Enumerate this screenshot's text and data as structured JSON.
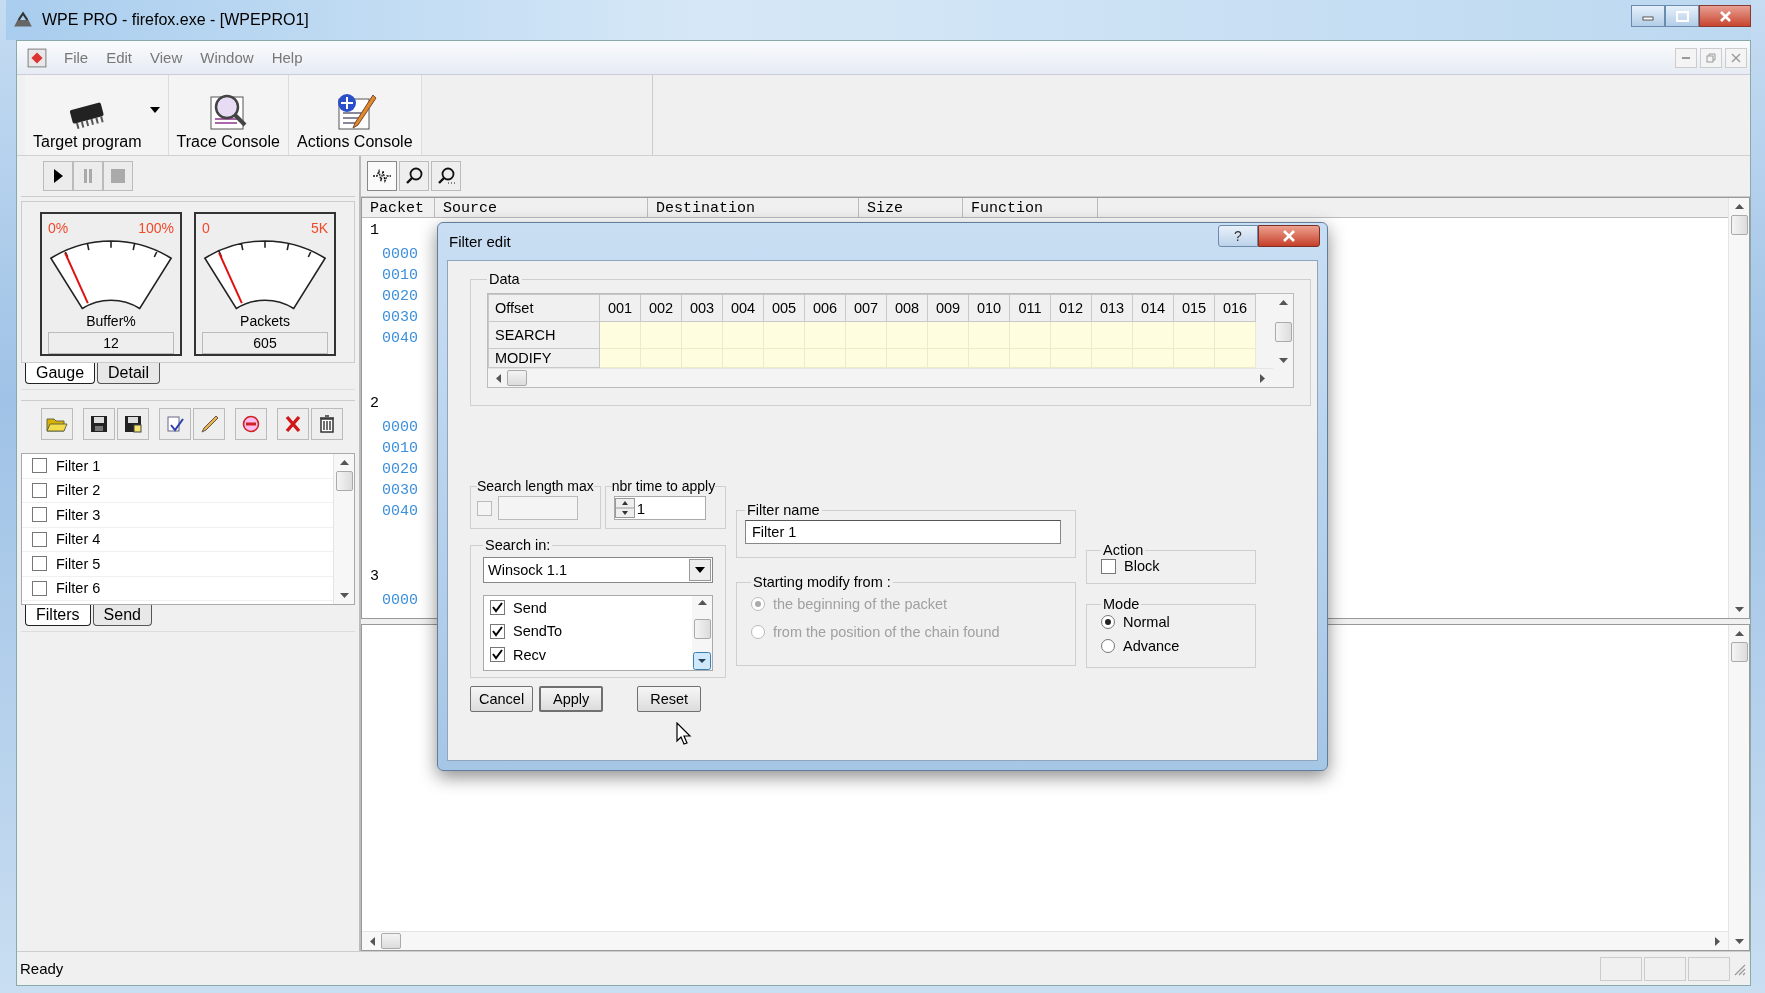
{
  "window": {
    "title": "WPE PRO - firefox.exe - [WPEPRO1]"
  },
  "menu": [
    "File",
    "Edit",
    "View",
    "Window",
    "Help"
  ],
  "toolbar": [
    {
      "label": "Target program",
      "kind": "chip",
      "dropdown": true
    },
    {
      "label": "Trace Console",
      "kind": "trace",
      "dropdown": false
    },
    {
      "label": "Actions Console",
      "kind": "actions",
      "dropdown": false
    }
  ],
  "gauges": [
    {
      "label": "Buffer%",
      "min": "0%",
      "max": "100%",
      "level": 0.12,
      "reading": "12"
    },
    {
      "label": "Packets",
      "min": "0",
      "max": "5K",
      "level": 0.12,
      "reading": "605"
    }
  ],
  "gauge_tabs": [
    {
      "label": "Gauge",
      "selected": true
    },
    {
      "label": "Detail",
      "selected": false
    }
  ],
  "filters": [
    {
      "label": "Filter 1",
      "checked": false
    },
    {
      "label": "Filter 2",
      "checked": false
    },
    {
      "label": "Filter 3",
      "checked": false
    },
    {
      "label": "Filter 4",
      "checked": false
    },
    {
      "label": "Filter 5",
      "checked": false
    },
    {
      "label": "Filter 6",
      "checked": false
    }
  ],
  "filter_tabs": [
    {
      "label": "Filters",
      "selected": true
    },
    {
      "label": "Send",
      "selected": false
    }
  ],
  "packet_table": {
    "columns": [
      "Packet",
      "Source",
      "Destination",
      "Size",
      "Function"
    ],
    "packets": [
      {
        "number": "1",
        "offsets": [
          "0000",
          "0010",
          "0020",
          "0030",
          "0040"
        ]
      },
      {
        "number": "2",
        "offsets": [
          "0000",
          "0010",
          "0020",
          "0030",
          "0040"
        ]
      },
      {
        "number": "3",
        "offsets": [
          "0000"
        ]
      }
    ]
  },
  "dialog": {
    "title": "Filter edit",
    "help": "?",
    "data_group": "Data",
    "grid": {
      "row_header": "Offset",
      "columns": [
        "001",
        "002",
        "003",
        "004",
        "005",
        "006",
        "007",
        "008",
        "009",
        "010",
        "011",
        "012",
        "013",
        "014",
        "015",
        "016"
      ],
      "rows": [
        "SEARCH",
        "MODIFY"
      ]
    },
    "search_length": {
      "label": "Search length max",
      "checked": false
    },
    "apply_times": {
      "label": "nbr time to apply",
      "value": "1"
    },
    "search_in": {
      "label": "Search in:",
      "select": "Winsock 1.1",
      "functions": [
        {
          "label": "Send",
          "checked": true
        },
        {
          "label": "SendTo",
          "checked": true
        },
        {
          "label": "Recv",
          "checked": true
        }
      ]
    },
    "filter_name": {
      "label": "Filter name",
      "value": "Filter 1"
    },
    "modify_from": {
      "label": "Starting modify from :",
      "disabled": true,
      "options": [
        {
          "label": "the beginning of the packet",
          "selected": true
        },
        {
          "label": "from the position of the chain found",
          "selected": false
        }
      ]
    },
    "action": {
      "label": "Action",
      "options": [
        {
          "label": "Block",
          "checked": false
        }
      ]
    },
    "mode": {
      "label": "Mode",
      "options": [
        {
          "label": "Normal",
          "selected": true
        },
        {
          "label": "Advance",
          "selected": false
        }
      ]
    },
    "buttons": [
      "Cancel",
      "Apply",
      "Reset"
    ]
  },
  "status_bar": {
    "text": "Ready"
  }
}
